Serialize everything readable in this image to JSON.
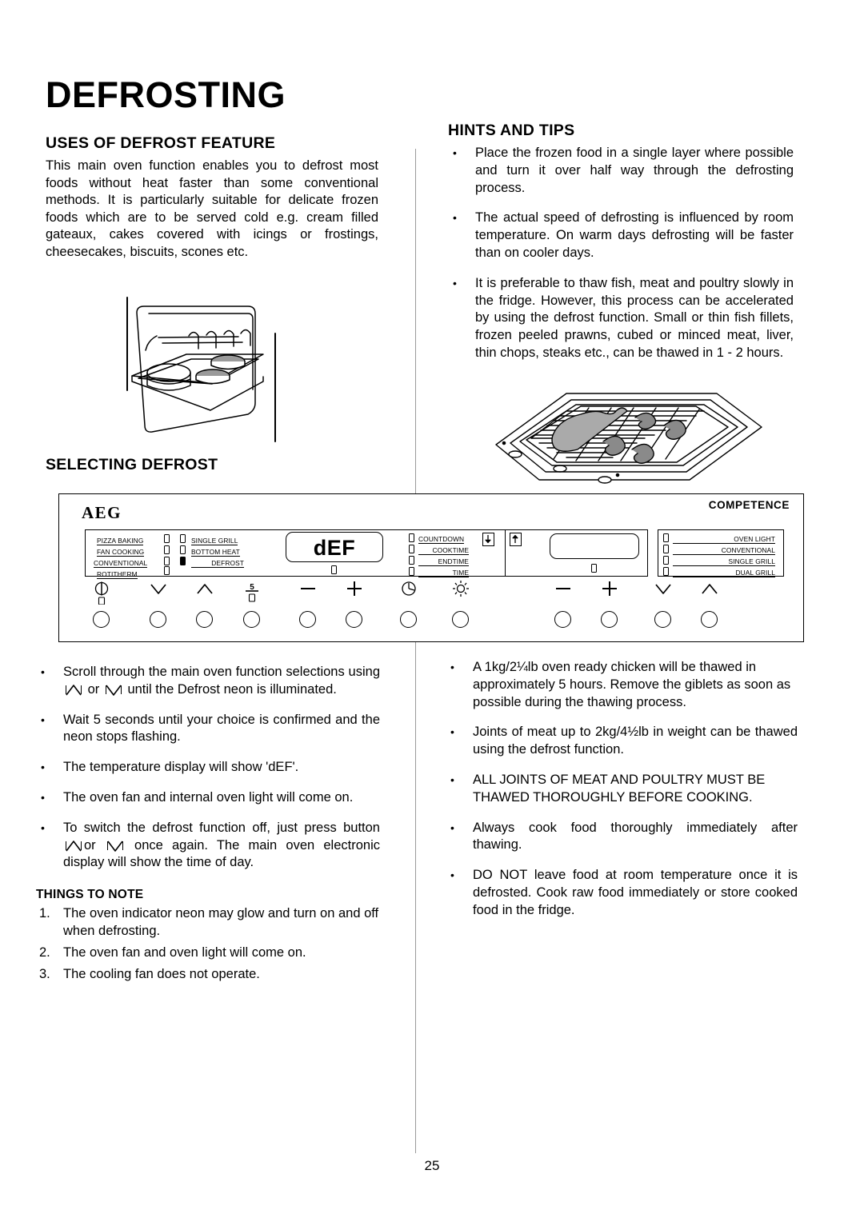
{
  "document": {
    "title": "DEFROSTING",
    "page_number": "25"
  },
  "uses": {
    "heading": "USES OF DEFROST FEATURE",
    "paragraph": "This main oven function enables you to defrost most foods without heat faster than some conventional methods.  It is particularly suitable for delicate frozen foods which are to be served cold e.g. cream filled gateaux, cakes covered with icings or frostings, cheesecakes, biscuits, scones etc."
  },
  "hints": {
    "heading": "HINTS AND TIPS",
    "bullets": [
      "Place the frozen food in a single layer where possible and turn it over half way through the defrosting process.",
      "The actual speed of defrosting is influenced by room temperature. On warm days defrosting will be faster than on cooler days.",
      "It is preferable to thaw fish, meat and poultry slowly in the fridge.  However, this process can be accelerated by using the defrost function. Small or thin fish fillets, frozen peeled prawns, cubed or minced meat, liver, thin chops, steaks etc., can be thawed in 1 - 2 hours."
    ]
  },
  "selecting": {
    "heading": "SELECTING DEFROST",
    "bullets": {
      "b1_a": "Scroll through the main oven function selections using",
      "b1_or": "or",
      "b1_b": "until the Defrost neon is illuminated.",
      "b2": "Wait 5 seconds until your choice is confirmed and the neon stops flashing.",
      "b3": "The temperature display will show 'dEF'.",
      "b4": "The oven fan and internal oven light will come on.",
      "b5_a": "To switch the defrost function off, just press button",
      "b5_or": "or",
      "b5_b": "once again.  The main oven electronic display will show the time of day."
    }
  },
  "things_to_note": {
    "heading": "THINGS TO NOTE",
    "items": [
      {
        "num": "1.",
        "text": "The oven indicator neon may glow and turn on and off when defrosting."
      },
      {
        "num": "2.",
        "text": "The oven fan and oven light will come on."
      },
      {
        "num": "3.",
        "text": "The cooling fan does not operate."
      }
    ]
  },
  "right_bullets": [
    "A 1kg/2¼lb oven ready chicken will be thawed in approximately 5 hours.  Remove the giblets as soon as possible during the thawing process.",
    "Joints of meat up to 2kg/4½lb in weight can be thawed using the defrost function.",
    "ALL JOINTS OF MEAT AND POULTRY MUST BE THAWED THOROUGHLY BEFORE COOKING.",
    "Always cook food thoroughly immediately after thawing.",
    "DO NOT leave food at room temperature once it is defrosted.  Cook raw food immediately or store cooked food in the fridge."
  ],
  "control_panel": {
    "brand": "AEG",
    "range": "COMPETENCE",
    "display_value": "dEF",
    "second_display_value": "",
    "functions_left": [
      {
        "label": "PIZZA BAKING",
        "active": false
      },
      {
        "label": "FAN COOKING",
        "active": false
      },
      {
        "label": "CONVENTIONAL",
        "active": false
      },
      {
        "label": "ROTITHERM",
        "active": false
      }
    ],
    "functions_right": [
      {
        "label": "SINGLE GRILL",
        "active": false
      },
      {
        "label": "BOTTOM HEAT",
        "active": false
      },
      {
        "label": "DEFROST",
        "active": true
      }
    ],
    "timer_labels": [
      {
        "label": "COUNTDOWN",
        "active": false
      },
      {
        "label": "COOKTIME",
        "active": false
      },
      {
        "label": "ENDTIME",
        "active": false
      },
      {
        "label": "TIME",
        "active": false
      }
    ],
    "grill_labels": [
      {
        "label": "OVEN LIGHT",
        "active": false
      },
      {
        "label": "CONVENTIONAL",
        "active": false
      },
      {
        "label": "SINGLE GRILL",
        "active": false
      },
      {
        "label": "DUAL GRILL",
        "active": false
      }
    ],
    "buttons_main": [
      "power-icon",
      "chevron-down-icon",
      "chevron-up-icon",
      "meat-probe-icon",
      "minus-icon",
      "plus-icon",
      "clock-icon",
      "light-icon"
    ],
    "buttons_second": [
      "minus-icon",
      "plus-icon",
      "chevron-down-icon",
      "chevron-up-icon"
    ],
    "arrow_left": "arrow-down-icon",
    "arrow_right": "arrow-up-icon"
  },
  "figures": {
    "oven_shelf": "oven-shelf-with-cakes-illustration",
    "grill_pan": "grill-pan-with-fish-and-prawns-illustration"
  }
}
